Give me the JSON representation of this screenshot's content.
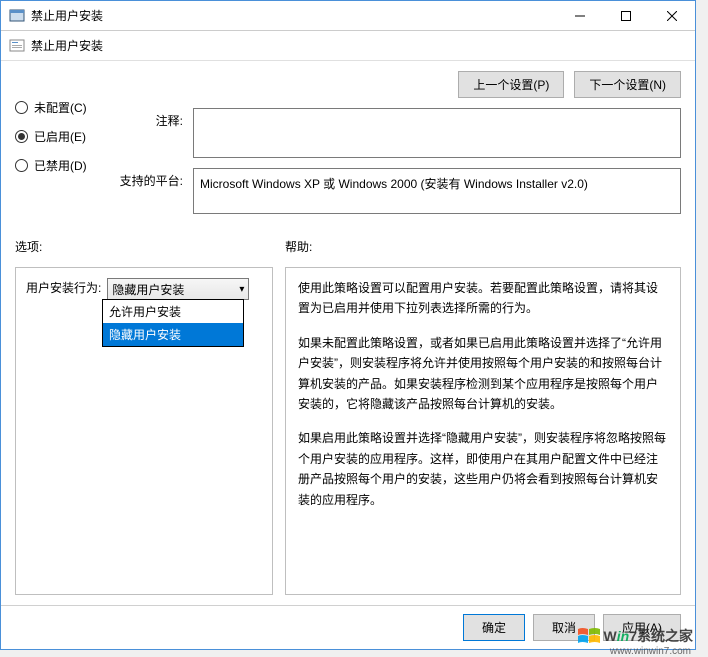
{
  "titlebar": {
    "title": "禁止用户安装"
  },
  "toolbar": {
    "title": "禁止用户安装"
  },
  "nav": {
    "prev": "上一个设置(P)",
    "next": "下一个设置(N)"
  },
  "radio": {
    "not_configured": "未配置(C)",
    "enabled": "已启用(E)",
    "disabled": "已禁用(D)",
    "selected": "enabled"
  },
  "fields": {
    "comment_label": "注释:",
    "comment_value": "",
    "supported_label": "支持的平台:",
    "supported_value": "Microsoft Windows XP 或 Windows 2000 (安装有 Windows Installer v2.0)"
  },
  "sections": {
    "options": "选项:",
    "help": "帮助:"
  },
  "options": {
    "behavior_label": "用户安装行为:",
    "selected": "隐藏用户安装",
    "items": [
      "允许用户安装",
      "隐藏用户安装"
    ]
  },
  "help": {
    "p1": "使用此策略设置可以配置用户安装。若要配置此策略设置，请将其设置为已启用并使用下拉列表选择所需的行为。",
    "p2": "如果未配置此策略设置，或者如果已启用此策略设置并选择了“允许用户安装”，则安装程序将允许并使用按照每个用户安装的和按照每台计算机安装的产品。如果安装程序检测到某个应用程序是按照每个用户安装的，它将隐藏该产品按照每台计算机的安装。",
    "p3": "如果启用此策略设置并选择“隐藏用户安装”，则安装程序将忽略按照每个用户安装的应用程序。这样，即使用户在其用户配置文件中已经注册产品按照每个用户的安装，这些用户仍将会看到按照每台计算机安装的应用程序。"
  },
  "footer": {
    "ok": "确定",
    "cancel": "取消",
    "apply": "应用(A)"
  },
  "watermark": {
    "brand": "7系统之家",
    "url": "www.winwin7.com"
  }
}
